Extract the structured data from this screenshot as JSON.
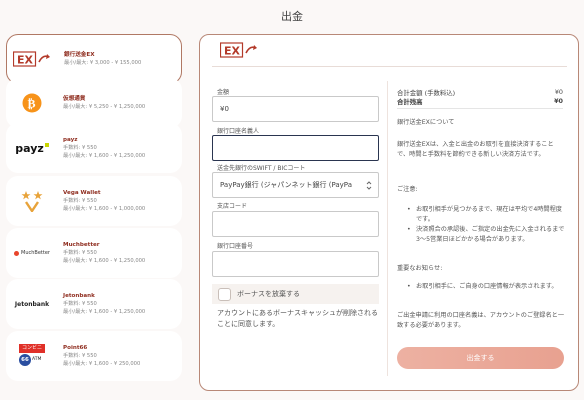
{
  "page": {
    "title": "出金"
  },
  "methods": [
    {
      "name": "銀行送金EX",
      "lines": [
        "最小/最大: ¥ 3,000 - ¥ 155,000"
      ],
      "logo": "ex-logo",
      "active": true
    },
    {
      "name": "仮想通貨",
      "lines": [
        "最小/最大: ¥ 5,250 - ¥ 1,250,000"
      ],
      "logo": "bitcoin-logo",
      "active": false
    },
    {
      "name": "payz",
      "lines": [
        "手数料: ¥ 550",
        "最小/最大: ¥ 1,600 - ¥ 1,250,000"
      ],
      "logo": "payz-logo",
      "active": false
    },
    {
      "name": "Vega Wallet",
      "lines": [
        "手数料: ¥ 550",
        "最小/最大: ¥ 1,600 - ¥ 1,000,000"
      ],
      "logo": "vega-logo",
      "active": false
    },
    {
      "name": "Muchbetter",
      "lines": [
        "手数料: ¥ 550",
        "最小/最大: ¥ 1,600 - ¥ 1,250,000"
      ],
      "logo": "muchbetter-logo",
      "active": false
    },
    {
      "name": "Jetonbank",
      "lines": [
        "手数料: ¥ 550",
        "最小/最大: ¥ 1,600 - ¥ 1,250,000"
      ],
      "logo": "jetonbank-logo",
      "active": false
    },
    {
      "name": "Point66",
      "lines": [
        "手数料: ¥ 550",
        "最小/最大: ¥ 1,600 - ¥ 250,000"
      ],
      "logo": "point66-logo",
      "active": false
    }
  ],
  "logos": {
    "payz": "payz",
    "muchbetter": "MuchBetter",
    "jetonbank": "Jetonbank",
    "point66_top": "コンビニ",
    "point66_bottom": "ATM"
  },
  "form": {
    "amount_label": "金額",
    "amount_value": "¥0",
    "holder_label": "銀行口座名義人",
    "holder_value": "",
    "swift_label": "送金先銀行のSWIFT / BICコート",
    "swift_value": "PayPay銀行 (ジャパンネット銀行 (PayPa",
    "branch_label": "支店コード",
    "branch_value": "",
    "account_label": "銀行口座番号",
    "account_value": "",
    "bonus_label": "ボーナスを放棄する",
    "bonus_note": "アカウントにあるボーナスキャッシュが削除されることに同意します。"
  },
  "summary": {
    "total_label": "合計金額 (手数料込)",
    "total_value": "¥0",
    "balance_label": "合計残高",
    "balance_value": "¥0"
  },
  "info": {
    "about": "銀行送金EXについて",
    "desc": "銀行送金EXは、入金と出金のお取引を直接決済することで、時間と手数料を節約できる新しい決済方法です。",
    "caution_title": "ご注意:",
    "caution_items": [
      "お取引相手が見つかるまで、現在は平均で4時間程度です。",
      "決済照合の承認後、ご指定の出金先に入金されるまで3〜5営業日ほどかかる場合があります。"
    ],
    "important_title": "重要なお知らせ:",
    "important_items": [
      "お取引相手に、ご自身の口座情報が表示されます。"
    ],
    "footer": "ご出金申請に利用の口座名義は、アカウントのご登録名と一致する必要があります。"
  },
  "submit_label": "出金する",
  "colors": {
    "accent": "#8f2d1f",
    "button": "#eba896",
    "border": "#b88877",
    "bitcoin": "#f7931a"
  }
}
